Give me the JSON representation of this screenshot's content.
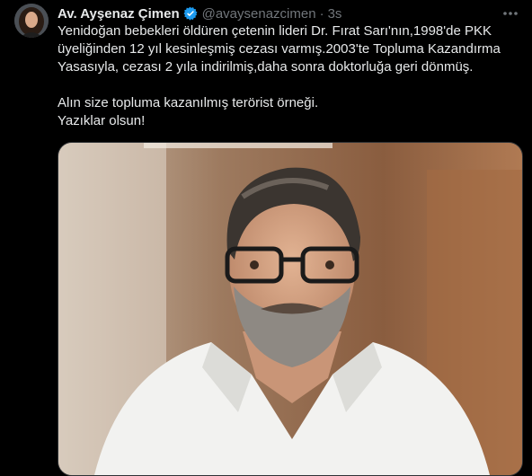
{
  "tweet": {
    "author_name": "Av. Ayşenaz Çimen",
    "handle": "@avaysenazcimen",
    "separator": "·",
    "time": "3s",
    "lines": [
      "Yenidoğan bebekleri öldüren çetenin lideri Dr. Fırat Sarı'nın,1998'de PKK",
      "üyeliğinden 12 yıl kesinleşmiş cezası varmış.2003'te Topluma Kazandırma",
      "Yasasıyla, cezası 2 yıla indirilmiş,daha sonra doktorluğa geri dönmüş.",
      "",
      "Alın size topluma kazanılmış terörist örneği.",
      "Yazıklar olsun!"
    ],
    "icons": {
      "verified": "verified-badge-icon",
      "more": "more-options-icon"
    },
    "colors": {
      "background": "#000000",
      "text": "#e7e9ea",
      "muted": "#71767b",
      "verified": "#1d9bf0"
    }
  }
}
